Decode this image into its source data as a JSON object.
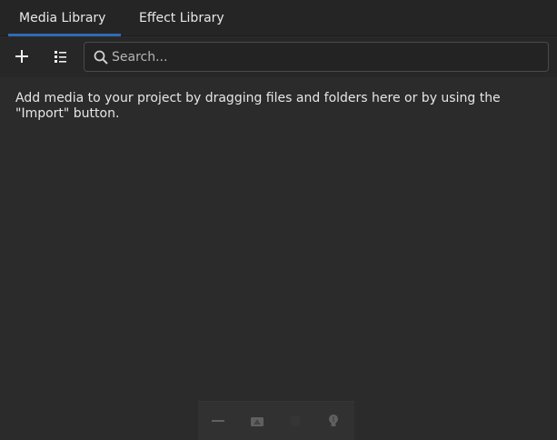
{
  "tabs": [
    {
      "label": "Media Library",
      "active": true
    },
    {
      "label": "Effect Library",
      "active": false
    }
  ],
  "toolbar": {
    "add_icon": "plus-icon",
    "view_icon": "list-view-icon",
    "search": {
      "placeholder": "Search...",
      "value": ""
    }
  },
  "content": {
    "empty_message": "Add media to your project by dragging files and folders here or by using the \"Import\" button."
  },
  "bottom_bar": {
    "icons": [
      "minus-icon",
      "shape-icon",
      "disabled-icon",
      "lightbulb-icon"
    ]
  },
  "colors": {
    "background": "#2b2b2b",
    "tab_bar": "#252525",
    "accent": "#2f6bb3",
    "text": "#e6e6e6"
  }
}
